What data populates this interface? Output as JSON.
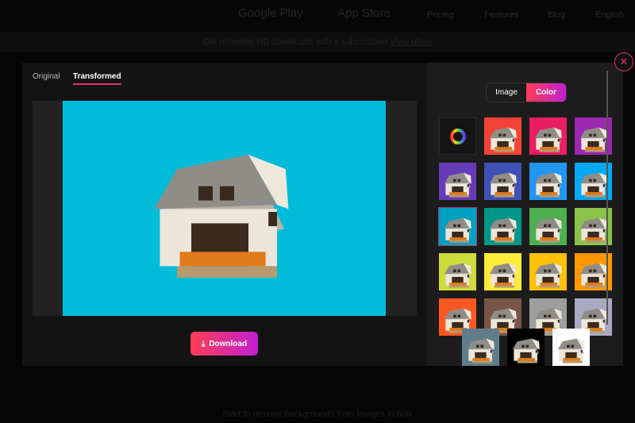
{
  "topbar": {
    "google_play": "Google Play",
    "app_store": "App Store",
    "nav": [
      "Pricing",
      "Features",
      "Blog",
      "English"
    ]
  },
  "banner": {
    "text": "Get unlimited HD downloads with a subscription",
    "link": "View plans"
  },
  "bottom_text": "Start to remove backgrounds from images in bulk",
  "modal": {
    "tabs": [
      {
        "label": "Original",
        "active": false
      },
      {
        "label": "Transformed",
        "active": true
      }
    ],
    "download_label": "Download",
    "segment": {
      "options": [
        "Image",
        "Color"
      ],
      "selected": "Color"
    },
    "preview_bg": "#00bcd8",
    "accent": "#e8336d",
    "swatches": [
      "#f44336",
      "#e91e63",
      "#9c27b0",
      "#673ab7",
      "#3f51b5",
      "#2196f3",
      "#03a9f4",
      "#00a0c0",
      "#009688",
      "#4caf50",
      "#8bc34a",
      "#cddc39",
      "#ffeb3b",
      "#ffc107",
      "#ff9800",
      "#ff5722",
      "#795548",
      "#9e9e9e",
      "#a9a9c4",
      "#607d8b",
      "#000000",
      "#ffffff"
    ],
    "selected_swatch": "#00a0c0"
  }
}
